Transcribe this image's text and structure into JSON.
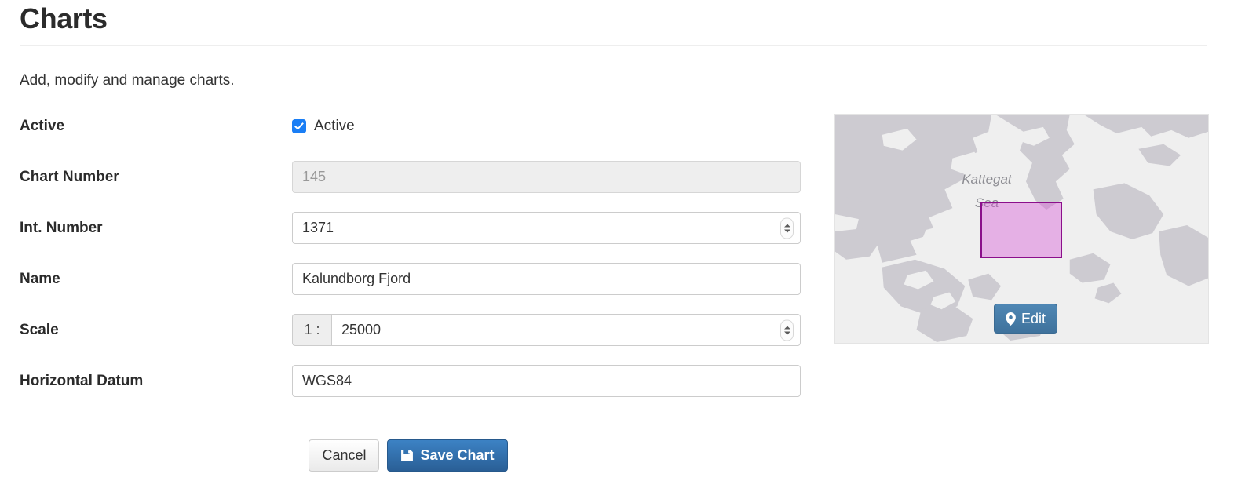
{
  "header": {
    "title": "Charts",
    "subtitle": "Add, modify and manage charts."
  },
  "form": {
    "rows": [
      {
        "label": "Active",
        "type": "checkbox",
        "checkbox_label": "Active",
        "checked": true
      },
      {
        "label": "Chart Number",
        "type": "text",
        "value": "145",
        "disabled": true
      },
      {
        "label": "Int. Number",
        "type": "number",
        "value": "1371",
        "disabled": false
      },
      {
        "label": "Name",
        "type": "text",
        "value": "Kalundborg Fjord",
        "disabled": false
      },
      {
        "label": "Scale",
        "type": "number",
        "value": "25000",
        "prefix": "1 :",
        "disabled": false
      },
      {
        "label": "Horizontal Datum",
        "type": "text",
        "value": "WGS84",
        "disabled": false
      }
    ]
  },
  "actions": {
    "cancel_label": "Cancel",
    "save_label": "Save Chart",
    "save_icon": "floppy-disk-icon"
  },
  "map": {
    "sea_label_line1": "Kattegat",
    "sea_label_line2": "Sea",
    "edit_label": "Edit",
    "edit_icon": "map-pin-icon",
    "colors": {
      "water": "#efefef",
      "land": "#cdcbd1",
      "bbox_border": "#8b0f8b",
      "bbox_fill": "#d658d6",
      "edit_button": "#4477a0"
    }
  },
  "theme": {
    "accent": "#1a7ef5",
    "primary_button": "#2a5f96",
    "text": "#333333"
  }
}
